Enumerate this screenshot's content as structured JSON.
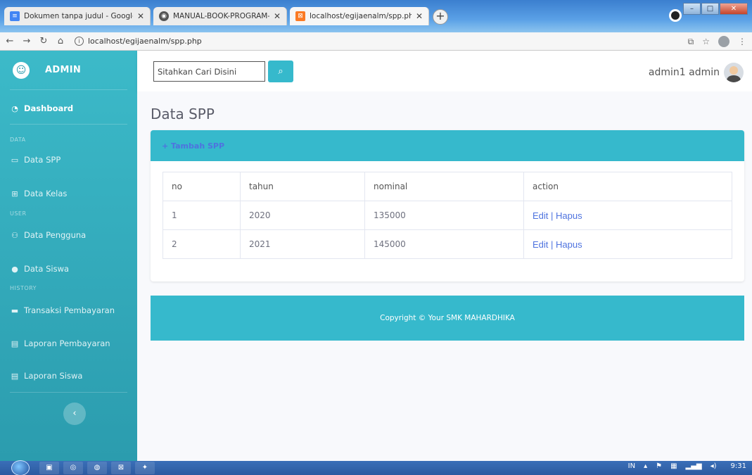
{
  "browser": {
    "tabs": [
      {
        "title": "Dokumen tanpa judul - Google D",
        "icon": "docs-icon",
        "color": "#4285f4"
      },
      {
        "title": "MANUAL-BOOK-PROGRAM-APL",
        "icon": "globe-icon",
        "color": "#555555"
      },
      {
        "title": "localhost/egijaenalm/spp.php",
        "icon": "xampp-icon",
        "color": "#fb7a24"
      }
    ],
    "url": "localhost/egijaenalm/spp.php"
  },
  "sidebar": {
    "brand": "ADMIN",
    "dashboard": "Dashboard",
    "heading_data": "DATA",
    "data_spp": "Data SPP",
    "data_kelas": "Data Kelas",
    "heading_user": "USER",
    "data_pengguna": "Data Pengguna",
    "data_siswa": "Data Siswa",
    "heading_history": "HISTORY",
    "transaksi": "Transaksi Pembayaran",
    "laporan_pembayaran": "Laporan Pembayaran",
    "laporan_siswa": "Laporan Siswa"
  },
  "topbar": {
    "search_value": "Sitahkan Cari Disini",
    "user_name": "admin1 admin"
  },
  "main": {
    "title": "Data SPP",
    "add_button": "+ Tambah SPP",
    "table": {
      "headers": [
        "no",
        "tahun",
        "nominal",
        "action"
      ],
      "rows": [
        {
          "no": "1",
          "tahun": "2020",
          "nominal": "135000",
          "edit": "Edit",
          "sep": " | ",
          "hapus": "Hapus"
        },
        {
          "no": "2",
          "tahun": "2021",
          "nominal": "145000",
          "edit": "Edit",
          "sep": " | ",
          "hapus": "Hapus"
        }
      ]
    },
    "footer": "Copyright © Your SMK MAHARDHIKA"
  },
  "taskbar": {
    "lang": "IN",
    "clock": "9:31"
  },
  "colors": {
    "accent": "#36b9cc",
    "link": "#4e73df"
  }
}
